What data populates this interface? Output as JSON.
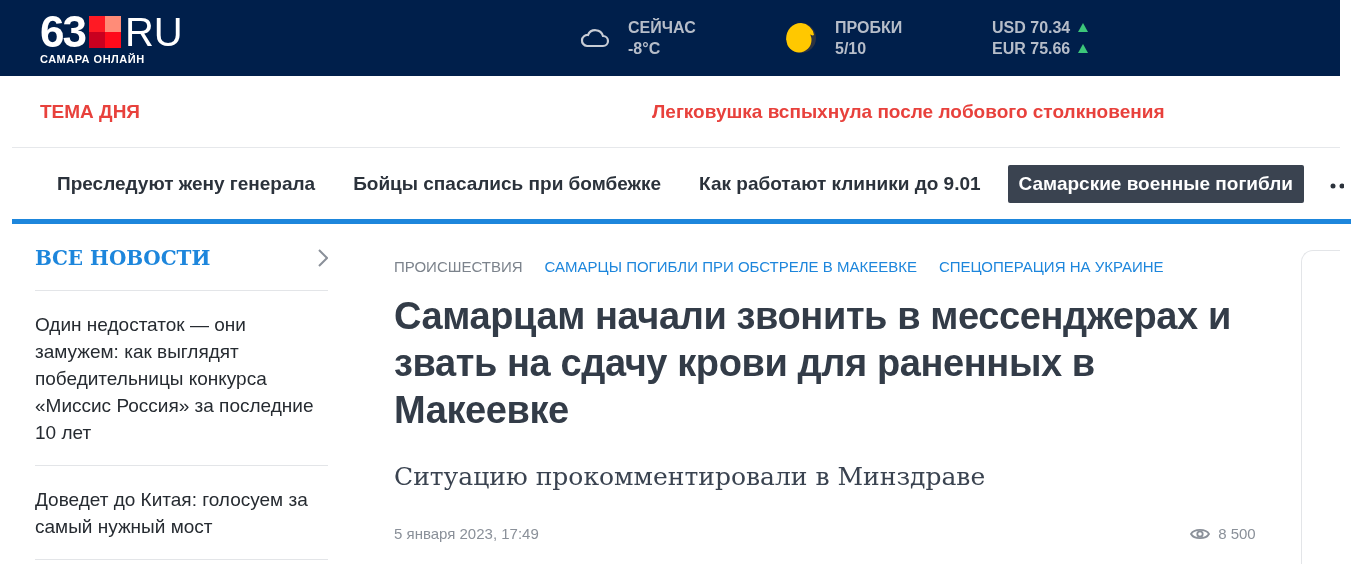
{
  "header": {
    "logo": {
      "number": "63",
      "suffix": "RU",
      "tagline": "САМАРА ОНЛАЙН"
    },
    "weather": {
      "label": "СЕЙЧАС",
      "value": "-8°C"
    },
    "traffic": {
      "label": "ПРОБКИ",
      "value": "5/10"
    },
    "rates": [
      {
        "text": "USD 70.34",
        "rising": true
      },
      {
        "text": "EUR 75.66",
        "rising": true
      }
    ]
  },
  "topic": {
    "label": "ТЕМА ДНЯ",
    "headline": "Легковушка вспыхнула после лобового столкновения"
  },
  "nav": [
    {
      "label": "Преследуют жену генерала",
      "selected": false
    },
    {
      "label": "Бойцы спасались при бомбежке",
      "selected": false
    },
    {
      "label": "Как работают клиники до 9.01",
      "selected": false
    },
    {
      "label": "Самарские военные погибли",
      "selected": true
    }
  ],
  "sidebar": {
    "title": "ВСЕ НОВОСТИ",
    "items": [
      "Один недостаток — они замужем: как выглядят победительницы конкурса «Миссис Россия» за последние 10 лет",
      "Доведет до Китая: голосуем за самый нужный мост"
    ]
  },
  "article": {
    "tags": [
      {
        "text": "ПРОИСШЕСТВИЯ",
        "kind": "rubric"
      },
      {
        "text": "САМАРЦЫ ПОГИБЛИ ПРИ ОБСТРЕЛЕ В МАКЕЕВКЕ",
        "kind": "link"
      },
      {
        "text": "СПЕЦОПЕРАЦИЯ НА УКРАИНЕ",
        "kind": "link"
      }
    ],
    "title": "Самарцам начали звонить в мессенджерах и звать на сдачу крови для раненных в Макеевке",
    "subtitle": "Ситуацию прокомментировали в Минздраве",
    "date": "5 января 2023, 17:49",
    "views": "8 500"
  }
}
